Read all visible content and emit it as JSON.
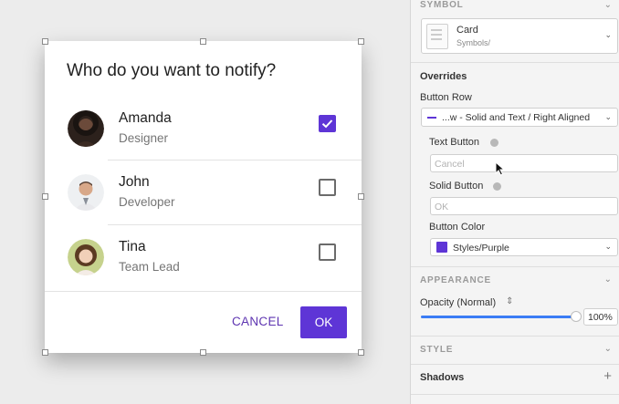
{
  "dialog": {
    "title": "Who do you want to notify?",
    "people": [
      {
        "name": "Amanda",
        "role": "Designer",
        "checked": true
      },
      {
        "name": "John",
        "role": "Developer",
        "checked": false
      },
      {
        "name": "Tina",
        "role": "Team Lead",
        "checked": false
      }
    ],
    "cancel_label": "CANCEL",
    "ok_label": "OK"
  },
  "inspector": {
    "symbol_header": "SYMBOL",
    "symbol_name": "Card",
    "symbol_source": "Symbols/",
    "overrides_label": "Overrides",
    "button_row_label": "Button Row",
    "button_row_value": "...w - Solid and Text / Right Aligned",
    "text_button_label": "Text Button",
    "text_button_placeholder": "Cancel",
    "solid_button_label": "Solid Button",
    "solid_button_placeholder": "OK",
    "button_color_label": "Button Color",
    "button_color_value": "Styles/Purple",
    "appearance_header": "APPEARANCE",
    "opacity_label": "Opacity (Normal)",
    "opacity_value": "100%",
    "opacity_level": 1.0,
    "style_header": "STYLE",
    "shadows_label": "Shadows"
  },
  "colors": {
    "accent": "#5e35d6",
    "slider": "#3b7cf5"
  }
}
